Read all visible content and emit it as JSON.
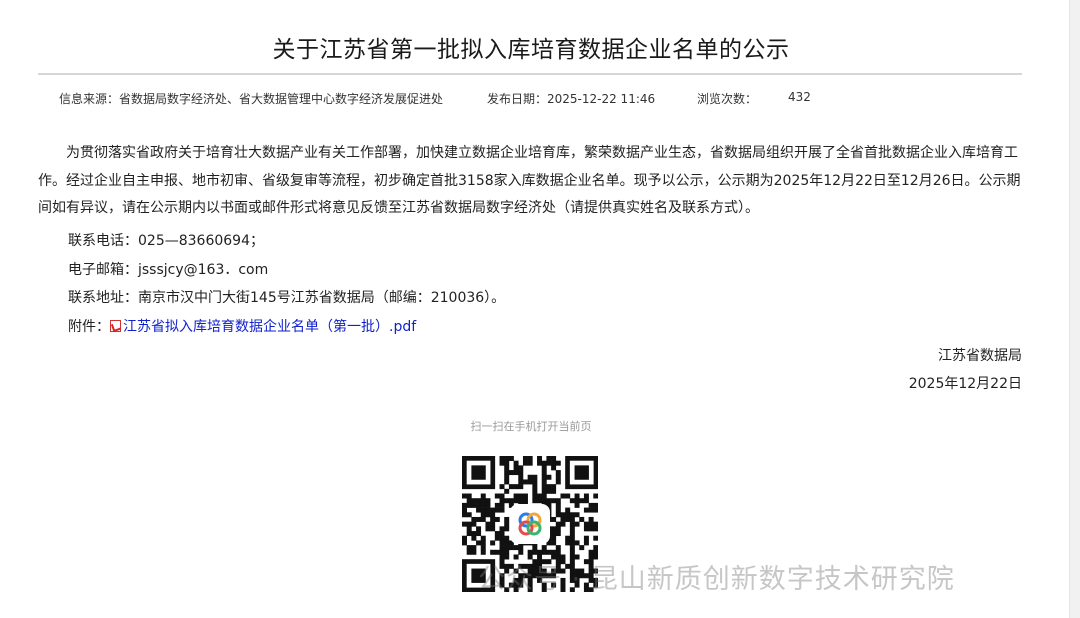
{
  "article": {
    "title": "关于江苏省第一批拟入库培育数据企业名单的公示",
    "meta": {
      "source": "信息来源：省数据局数字经济处、省大数据管理中心数字经济发展促进处",
      "date_label": "发布日期：2025-12-22 11:46",
      "views_label": "浏览次数：",
      "views": "432"
    },
    "body": "为贯彻落实省政府关于培育壮大数据产业有关工作部署，加快建立数据企业培育库，繁荣数据产业生态，省数据局组织开展了全省首批数据企业入库培育工作。经过企业自主申报、地市初审、省级复审等流程，初步确定首批3158家入库数据企业名单。现予以公示，公示期为2025年12月22日至12月26日。公示期间如有异议，请在公示期内以书面或邮件形式将意见反馈至江苏省数据局数字经济处（请提供真实姓名及联系方式）。",
    "phone": "联系电话：025—83660694；",
    "email": "电子邮箱：jsssjcy@163．com",
    "address": "联系地址：南京市汉中门大街145号江苏省数据局（邮编：210036）。",
    "attachment_label": "附件：",
    "attachment_link": "江苏省拟入库培育数据企业名单（第一批）.pdf",
    "signature_org": "江苏省数据局",
    "signature_date": "2025年12月22日"
  },
  "qr": {
    "caption": "扫一扫在手机打开当前页"
  },
  "watermark": "公众号 · 昆山新质创新数字技术研究院",
  "colors": {
    "link": "#1122cc",
    "rule": "#d6d6d6"
  },
  "icons": [
    "pdf-icon",
    "qr-code",
    "qr-center-logo-icon"
  ]
}
